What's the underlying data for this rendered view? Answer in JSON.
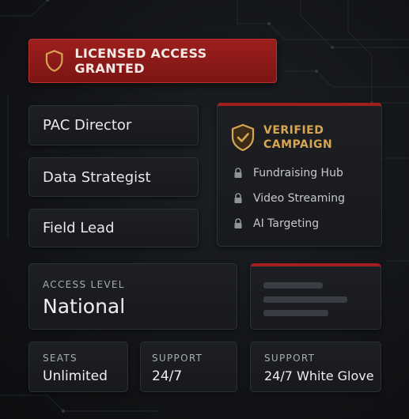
{
  "banner": {
    "text": "LICENSED ACCESS GRANTED",
    "icon": "shield-icon"
  },
  "roles": [
    "PAC Director",
    "Data Strategist",
    "Field Lead"
  ],
  "verified": {
    "title_line1": "VERIFIED",
    "title_line2": "CAMPAIGN",
    "icon": "shield-check-icon",
    "features": [
      "Fundraising Hub",
      "Video Streaming",
      "AI Targeting"
    ]
  },
  "access": {
    "label": "ACCESS LEVEL",
    "value": "National"
  },
  "stats": [
    {
      "label": "SEATS",
      "value": "Unlimited"
    },
    {
      "label": "SUPPORT",
      "value": "24/7"
    },
    {
      "label": "SUPPORT",
      "value": "24/7 White Glove"
    }
  ],
  "colors": {
    "accent_red": "#9c1f1d",
    "gold": "#d7a650",
    "background": "#121417",
    "card": "#1b1d21"
  }
}
